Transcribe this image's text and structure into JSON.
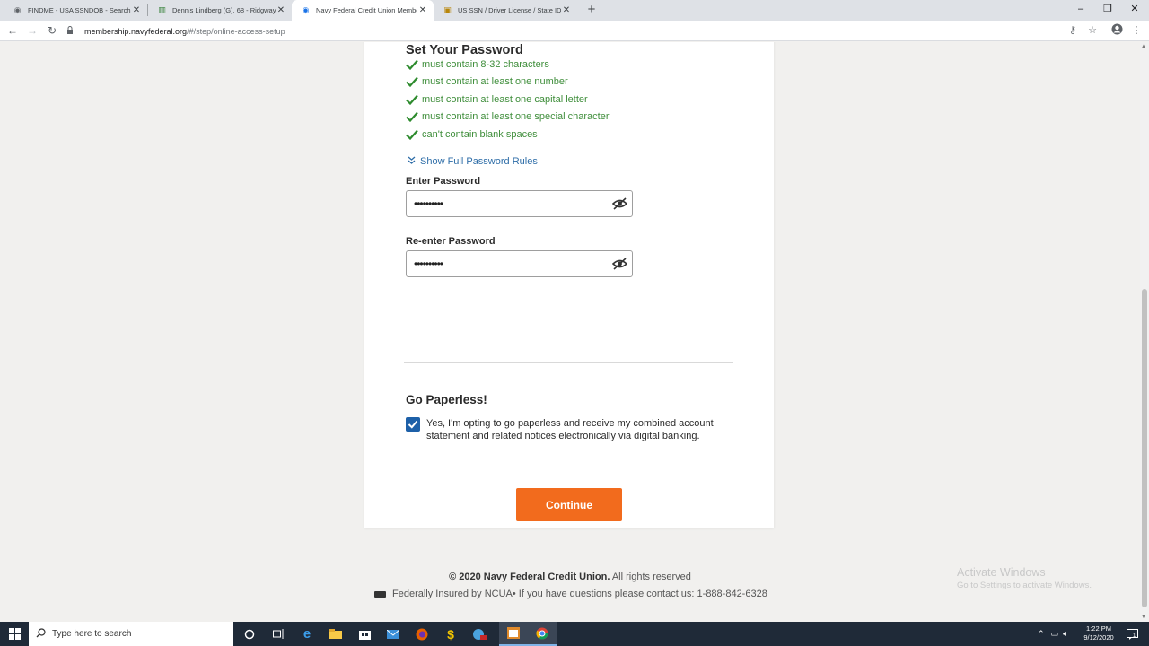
{
  "browser": {
    "tabs": [
      {
        "title": "FINDME - USA SSNDOB - Search",
        "icon": "globe-icon",
        "active": false
      },
      {
        "title": "Dennis Lindberg (G), 68 - Ridgway",
        "icon": "building-icon",
        "active": false
      },
      {
        "title": "Navy Federal Credit Union Membership",
        "icon": "globe-icon",
        "active": true
      },
      {
        "title": "US SSN / Driver License / State ID",
        "icon": "site-icon",
        "active": false
      }
    ],
    "url_host": "membership.navyfederal.org",
    "url_path": "/#/step/online-access-setup"
  },
  "form": {
    "title": "Set Your Password",
    "rules": [
      "must contain 8-32 characters",
      "must contain at least one number",
      "must contain at least one capital letter",
      "must contain at least one special character",
      "can't contain blank spaces"
    ],
    "show_rules_label": "Show Full Password Rules",
    "enter_password_label": "Enter Password",
    "enter_password_value": "••••••••••",
    "reenter_password_label": "Re-enter Password",
    "reenter_password_value": "••••••••••",
    "paperless_title": "Go Paperless!",
    "paperless_text": "Yes, I'm opting to go paperless and receive my combined account statement and related notices electronically via digital banking.",
    "paperless_checked": true,
    "continue_label": "Continue"
  },
  "footer": {
    "copyright_bold": "© 2020 Navy Federal Credit Union.",
    "copyright_rest": " All rights reserved",
    "ncua_link": "Federally Insured by NCUA",
    "contact_text": " • If you have questions please contact us: 1-888-842-6328"
  },
  "watermark": {
    "line1": "Activate Windows",
    "line2": "Go to Settings to activate Windows."
  },
  "taskbar": {
    "search_placeholder": "Type here to search",
    "time": "1:22 PM",
    "date": "9/12/2020",
    "notification_count": "1"
  },
  "colors": {
    "accent_orange": "#f26b1d",
    "success_green": "#3f8e3b",
    "link_blue": "#2f6ea8",
    "checkbox_blue": "#1d60a8"
  }
}
